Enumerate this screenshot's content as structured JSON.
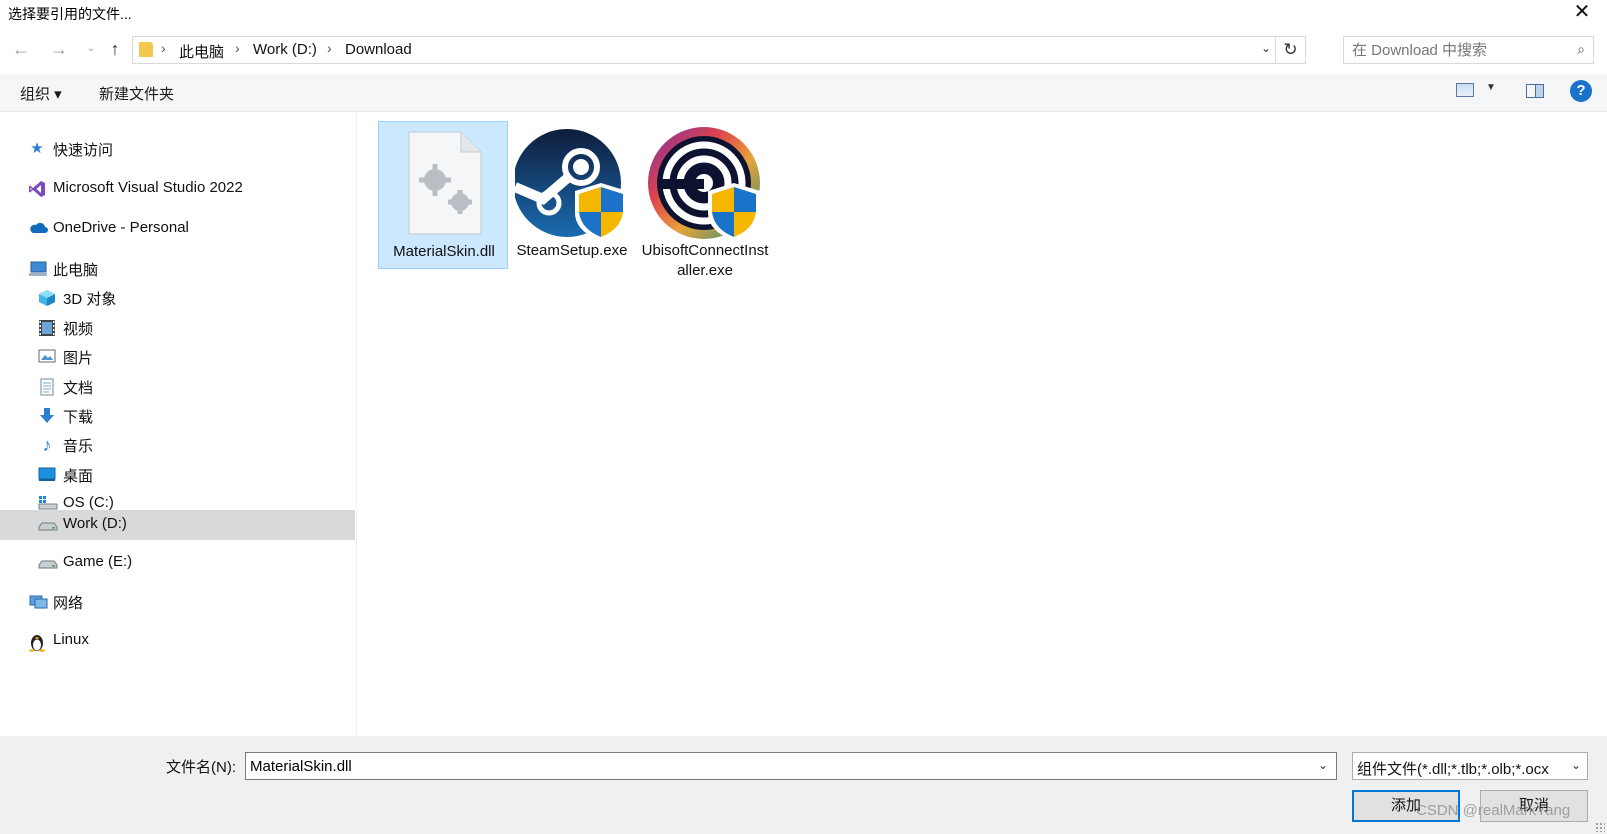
{
  "window": {
    "title": "选择要引用的文件..."
  },
  "address_bar": {
    "crumbs": [
      "此电脑",
      "Work (D:)",
      "Download"
    ],
    "search_placeholder": "在 Download 中搜索"
  },
  "toolbar": {
    "organize_label": "组织 ▾",
    "new_folder_label": "新建文件夹"
  },
  "sidebar": {
    "items": [
      {
        "label": "快速访问",
        "icon": "star-icon"
      },
      {
        "label": "Microsoft Visual Studio 2022",
        "icon": "visual-studio-icon"
      },
      {
        "label": "OneDrive - Personal",
        "icon": "onedrive-cloud-icon"
      },
      {
        "label": "此电脑",
        "icon": "this-pc-icon"
      },
      {
        "label": "3D 对象",
        "icon": "3d-objects-icon"
      },
      {
        "label": "视频",
        "icon": "video-icon"
      },
      {
        "label": "图片",
        "icon": "pictures-icon"
      },
      {
        "label": "文档",
        "icon": "documents-icon"
      },
      {
        "label": "下载",
        "icon": "download-arrow-icon"
      },
      {
        "label": "音乐",
        "icon": "music-note-icon"
      },
      {
        "label": "桌面",
        "icon": "desktop-icon"
      },
      {
        "label": "OS (C:)",
        "icon": "system-drive-icon"
      },
      {
        "label": "Work (D:)",
        "icon": "drive-icon",
        "selected": true
      },
      {
        "label": "Game (E:)",
        "icon": "drive-icon"
      },
      {
        "label": "网络",
        "icon": "network-icon"
      },
      {
        "label": "Linux",
        "icon": "linux-penguin-icon"
      }
    ]
  },
  "files": [
    {
      "name": "MaterialSkin.dll",
      "icon": "dll-file-icon",
      "selected": true
    },
    {
      "name": "SteamSetup.exe",
      "icon": "steam-installer-icon"
    },
    {
      "name": "UbisoftConnectInstaller.exe",
      "icon": "ubisoft-connect-installer-icon"
    }
  ],
  "footer": {
    "filename_label": "文件名(N):",
    "filename_value": "MaterialSkin.dll",
    "filter_value": "组件文件(*.dll;*.tlb;*.olb;*.ocx",
    "add_button": "添加",
    "cancel_button": "取消"
  },
  "watermark": "CSDN @realMarkYang",
  "colors": {
    "selection": "#cce8ff",
    "accent": "#0078d7",
    "sidebar_selected": "#d9d9d9"
  }
}
